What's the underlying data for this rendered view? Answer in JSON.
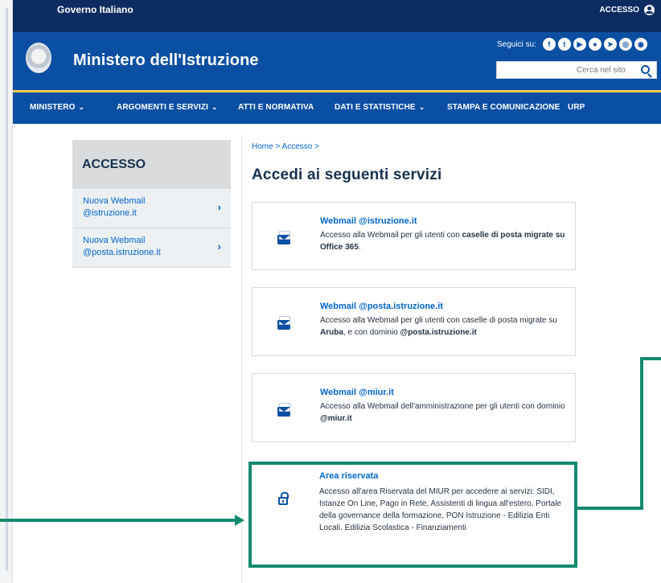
{
  "topbar": {
    "gov_label": "Governo Italiano",
    "access_label": "ACCESSO"
  },
  "header": {
    "site_title": "Ministero dell'Istruzione",
    "follow_label": "Seguici su:",
    "social": [
      {
        "icon": "facebook-icon",
        "glyph": "f"
      },
      {
        "icon": "twitter-icon",
        "glyph": "t"
      },
      {
        "icon": "youtube-icon",
        "glyph": "▶"
      },
      {
        "icon": "flickr-icon",
        "glyph": "●"
      },
      {
        "icon": "telegram-icon",
        "glyph": "➤"
      },
      {
        "icon": "instagram-icon",
        "glyph": "◎"
      },
      {
        "icon": "rss-icon",
        "glyph": "◉"
      }
    ],
    "search_placeholder": "Cerca nel sito"
  },
  "nav": {
    "items": [
      {
        "label": "MINISTERO",
        "dropdown": true
      },
      {
        "label": "ARGOMENTI E SERVIZI",
        "dropdown": true
      },
      {
        "label": "ATTI E NORMATIVA",
        "dropdown": false
      },
      {
        "label": "DATI E STATISTICHE",
        "dropdown": true
      },
      {
        "label": "STAMPA E COMUNICAZIONE",
        "dropdown": false
      },
      {
        "label": "URP",
        "dropdown": false
      }
    ]
  },
  "sidebar": {
    "heading": "ACCESSO",
    "items": [
      {
        "label": "Nuova Webmail @istruzione.it"
      },
      {
        "label": "Nuova Webmail @posta.istruzione.it"
      }
    ]
  },
  "main": {
    "breadcrumb": "Home > Accesso >",
    "title": "Accedi ai seguenti servizi",
    "cards": [
      {
        "title": "Webmail @istruzione.it",
        "desc_plain": "Accesso alla Webmail per gli utenti con ",
        "desc_bold": "caselle di posta migrate su Office 365",
        "desc_end": "."
      },
      {
        "title": "Webmail @posta.istruzione.it",
        "desc_plain": "Accesso alla Webmail per gli utenti con caselle di posta migrate su ",
        "desc_bold": "Aruba",
        "desc_mid": ", e con dominio ",
        "desc_bold2": "@posta.istruzione.it"
      },
      {
        "title": "Webmail @miur.it",
        "desc_plain": "Accesso alla Webmail dell'amministrazione per gli utenti con dominio ",
        "desc_bold": "@miur.it"
      },
      {
        "title": "Area riservata",
        "desc_plain": "Accesso all'area Riservata del MIUR per accedere ai servizi: SIDI, Istanze On Line, Pago in Rete, Assistenti di lingua all'estero, Portale della governance della formazione, PON Istruzione - Edilizia Enti Locali. Edilizia Scolastica - Finanziamenti"
      }
    ]
  },
  "colors": {
    "topbar": "#0d2c60",
    "header": "#0b4fa2",
    "accent_yellow": "#f7c948",
    "link_blue": "#0066cc",
    "highlight_green": "#138a70"
  }
}
